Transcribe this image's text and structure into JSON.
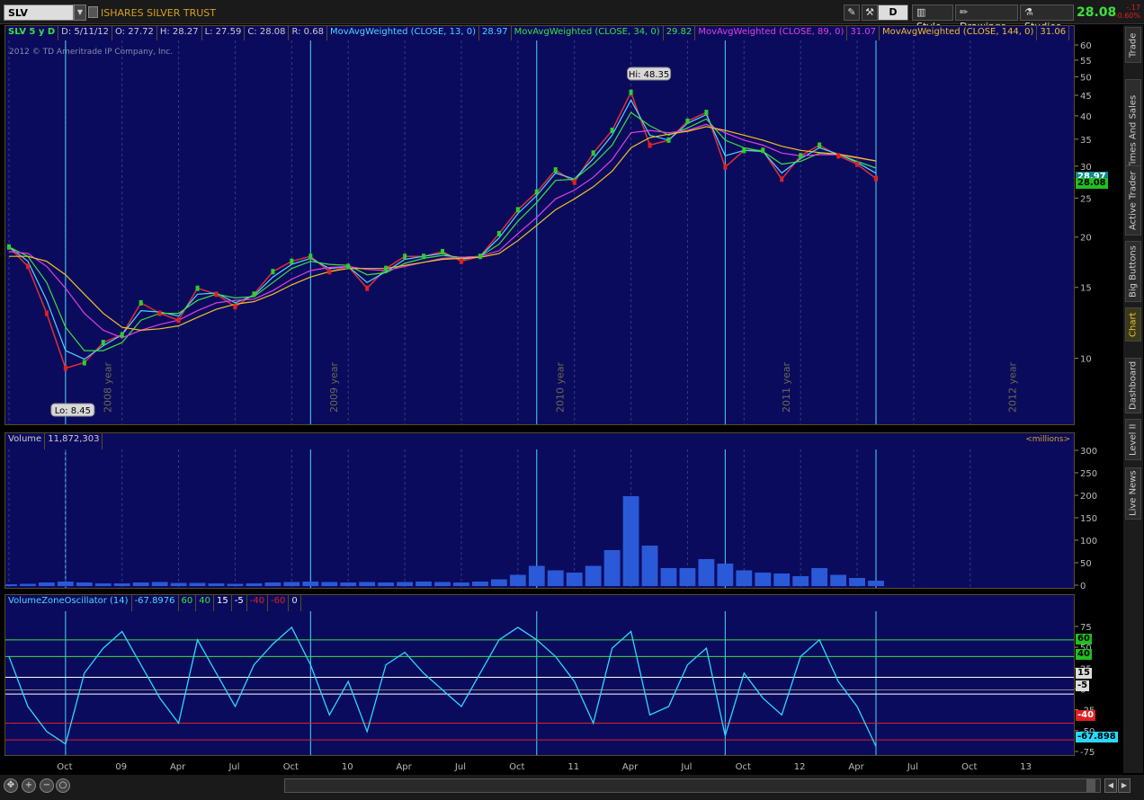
{
  "toolbar": {
    "symbol": "SLV",
    "description": "ISHARES SILVER TRUST",
    "aggregation": "D",
    "style_label": "Style",
    "drawings_label": "Drawings",
    "studies_label": "Studies",
    "last_price": "28.08",
    "net_change": "-.17",
    "pct_change": "-0.60%"
  },
  "price_panel": {
    "header": {
      "symbol_label": "SLV 5 y D",
      "date": "D: 5/11/12",
      "open": "O: 27.72",
      "high": "H: 28.27",
      "low": "L: 27.59",
      "close": "C: 28.08",
      "range": "R: 0.68",
      "ma13_label": "MovAvgWeighted (CLOSE, 13, 0)",
      "ma13_value": "28.97",
      "ma34_label": "MovAvgWeighted (CLOSE, 34, 0)",
      "ma34_value": "29.82",
      "ma89_label": "MovAvgWeighted (CLOSE, 89, 0)",
      "ma89_value": "31.07",
      "ma144_label": "MovAvgWeighted (CLOSE, 144, 0)",
      "ma144_value": "31.06"
    },
    "copyright": "2012 © TD Ameritrade IP Company, Inc.",
    "hi_label": "Hi: 48.35",
    "lo_label": "Lo: 8.45",
    "price_tag_1": "28.97",
    "price_tag_2": "28.08"
  },
  "volume_panel": {
    "label": "Volume",
    "value": "11,872,303",
    "units": "<millions>"
  },
  "oscillator_panel": {
    "label": "VolumeZoneOscillator (14)",
    "value": "-67.8976",
    "levels": [
      "60",
      "40",
      "15",
      "-5",
      "-40",
      "-60",
      "0"
    ],
    "tag_current": "-67.898"
  },
  "x_axis": {
    "labels": [
      "Oct",
      "09",
      "Apr",
      "Jul",
      "Oct",
      "10",
      "Apr",
      "Jul",
      "Oct",
      "11",
      "Apr",
      "Jul",
      "Oct",
      "12",
      "Apr",
      "Jul",
      "Oct",
      "13"
    ],
    "year_watermarks": [
      "2008 year",
      "2009 year",
      "2010 year",
      "2011 year",
      "2012 year"
    ]
  },
  "side_tabs": [
    "Trade",
    "Times And Sales",
    "Active Trader",
    "Big Buttons",
    "Chart",
    "Dashboard",
    "Level II",
    "Live News"
  ],
  "chart_data": [
    {
      "type": "line",
      "title": "SLV 5 y D",
      "ylabel": "",
      "yscale": "log",
      "ylim": [
        7,
        60
      ],
      "y_ticks": [
        10,
        15,
        20,
        25,
        30,
        35,
        40,
        45,
        50,
        55,
        60
      ],
      "x": [
        "2008-07",
        "2008-08",
        "2008-09",
        "2008-10",
        "2008-11",
        "2008-12",
        "2009-01",
        "2009-02",
        "2009-03",
        "2009-04",
        "2009-05",
        "2009-06",
        "2009-07",
        "2009-08",
        "2009-09",
        "2009-10",
        "2009-11",
        "2009-12",
        "2010-01",
        "2010-02",
        "2010-03",
        "2010-04",
        "2010-05",
        "2010-06",
        "2010-07",
        "2010-08",
        "2010-09",
        "2010-10",
        "2010-11",
        "2010-12",
        "2011-01",
        "2011-02",
        "2011-03",
        "2011-04",
        "2011-05",
        "2011-06",
        "2011-07",
        "2011-08",
        "2011-09",
        "2011-10",
        "2011-11",
        "2011-12",
        "2012-01",
        "2012-02",
        "2012-03",
        "2012-04",
        "2012-05"
      ],
      "series": [
        {
          "name": "SLV",
          "values": [
            19,
            17,
            13,
            9.5,
            9.8,
            11,
            11.5,
            13.8,
            13,
            12.5,
            15,
            14.5,
            13.5,
            14.5,
            16.5,
            17.5,
            18,
            16.5,
            17,
            15,
            16.8,
            18,
            18,
            18.5,
            17.5,
            18,
            20.5,
            23.5,
            26,
            29.5,
            27.5,
            32.5,
            37,
            46,
            34,
            35,
            39,
            41,
            30,
            33,
            33,
            28,
            32,
            34,
            32,
            30.5,
            28.08
          ]
        },
        {
          "name": "MovAvgWeighted (CLOSE, 13, 0)",
          "values": [
            19,
            17.5,
            14,
            10.5,
            10,
            10.8,
            11.5,
            13.2,
            13.1,
            12.8,
            14.5,
            14.6,
            13.8,
            14.4,
            16,
            17.2,
            17.8,
            16.8,
            17,
            15.5,
            16.5,
            17.7,
            18,
            18.3,
            17.7,
            18,
            20,
            23,
            25.5,
            29,
            28,
            31.5,
            36,
            44,
            36,
            35,
            38.5,
            40.5,
            32,
            33,
            32.8,
            29,
            31.5,
            33.5,
            32.3,
            30.8,
            28.97
          ]
        },
        {
          "name": "MovAvgWeighted (CLOSE, 34, 0)",
          "values": [
            19,
            18,
            15.5,
            12,
            10.5,
            10.5,
            11,
            12.5,
            13,
            13,
            14,
            14.5,
            14.2,
            14.3,
            15.5,
            16.8,
            17.5,
            17.2,
            17.1,
            16.2,
            16.4,
            17.3,
            17.8,
            18.1,
            17.9,
            18,
            19.3,
            22,
            24.5,
            27.8,
            28,
            30.5,
            34,
            41,
            38,
            36,
            37.5,
            39.5,
            35,
            33.5,
            32.8,
            30.5,
            31,
            32.5,
            32.3,
            31,
            29.82
          ]
        },
        {
          "name": "MovAvgWeighted (CLOSE, 89, 0)",
          "values": [
            18.5,
            18.3,
            17,
            15,
            13,
            11.8,
            11.3,
            11.8,
            12.2,
            12.5,
            13.2,
            13.8,
            14,
            14.1,
            14.8,
            15.8,
            16.6,
            16.9,
            17,
            16.7,
            16.6,
            17,
            17.4,
            17.8,
            17.9,
            18,
            18.6,
            20.5,
            22.5,
            25,
            26.3,
            28.3,
            31.3,
            36.5,
            37,
            36.5,
            37,
            38.3,
            36.5,
            35,
            34,
            32.5,
            32,
            32.2,
            32.2,
            31.6,
            31.07
          ]
        },
        {
          "name": "MovAvgWeighted (CLOSE, 144, 0)",
          "values": [
            18,
            18,
            17.5,
            16.2,
            14.5,
            13,
            12,
            11.8,
            11.9,
            12.1,
            12.7,
            13.3,
            13.7,
            13.9,
            14.5,
            15.3,
            16,
            16.5,
            16.8,
            16.8,
            16.8,
            17.1,
            17.4,
            17.7,
            17.8,
            17.9,
            18.3,
            19.7,
            21.5,
            23.5,
            25,
            26.8,
            29.3,
            33.5,
            35.5,
            36.2,
            36.8,
            37.8,
            37,
            36,
            35,
            33.8,
            33,
            32.6,
            32.3,
            31.7,
            31.06
          ]
        }
      ],
      "annotations": [
        "Hi: 48.35",
        "Lo: 8.45"
      ],
      "grid": true
    },
    {
      "type": "bar",
      "title": "Volume",
      "ylabel": "<millions>",
      "ylim": [
        0,
        300
      ],
      "y_ticks": [
        0,
        50,
        100,
        150,
        200,
        250,
        300
      ],
      "x": [
        "2008-07",
        "2008-08",
        "2008-09",
        "2008-10",
        "2008-11",
        "2008-12",
        "2009-01",
        "2009-02",
        "2009-03",
        "2009-04",
        "2009-05",
        "2009-06",
        "2009-07",
        "2009-08",
        "2009-09",
        "2009-10",
        "2009-11",
        "2009-12",
        "2010-01",
        "2010-02",
        "2010-03",
        "2010-04",
        "2010-05",
        "2010-06",
        "2010-07",
        "2010-08",
        "2010-09",
        "2010-10",
        "2010-11",
        "2010-12",
        "2011-01",
        "2011-02",
        "2011-03",
        "2011-04",
        "2011-05",
        "2011-06",
        "2011-07",
        "2011-08",
        "2011-09",
        "2011-10",
        "2011-11",
        "2011-12",
        "2012-01",
        "2012-02",
        "2012-03",
        "2012-04",
        "2012-05"
      ],
      "values": [
        4,
        5,
        8,
        10,
        8,
        6,
        6,
        8,
        9,
        7,
        7,
        6,
        5,
        6,
        8,
        9,
        10,
        9,
        8,
        9,
        8,
        9,
        10,
        9,
        8,
        10,
        15,
        25,
        45,
        35,
        30,
        45,
        80,
        200,
        90,
        40,
        40,
        60,
        50,
        35,
        30,
        28,
        22,
        40,
        25,
        18,
        12
      ]
    },
    {
      "type": "line",
      "title": "VolumeZoneOscillator (14)",
      "ylim": [
        -75,
        90
      ],
      "y_ticks": [
        75,
        50,
        25,
        0,
        -25,
        -50,
        -75
      ],
      "levels": [
        60,
        40,
        15,
        -5,
        -40,
        -60,
        0
      ],
      "x": [
        "2008-07",
        "2008-08",
        "2008-09",
        "2008-10",
        "2008-11",
        "2008-12",
        "2009-01",
        "2009-02",
        "2009-03",
        "2009-04",
        "2009-05",
        "2009-06",
        "2009-07",
        "2009-08",
        "2009-09",
        "2009-10",
        "2009-11",
        "2009-12",
        "2010-01",
        "2010-02",
        "2010-03",
        "2010-04",
        "2010-05",
        "2010-06",
        "2010-07",
        "2010-08",
        "2010-09",
        "2010-10",
        "2010-11",
        "2010-12",
        "2011-01",
        "2011-02",
        "2011-03",
        "2011-04",
        "2011-05",
        "2011-06",
        "2011-07",
        "2011-08",
        "2011-09",
        "2011-10",
        "2011-11",
        "2011-12",
        "2012-01",
        "2012-02",
        "2012-03",
        "2012-04",
        "2012-05"
      ],
      "series": [
        {
          "name": "VolumeZoneOscillator",
          "values": [
            40,
            -20,
            -50,
            -65,
            20,
            50,
            70,
            30,
            -10,
            -40,
            60,
            20,
            -20,
            30,
            55,
            75,
            30,
            -30,
            10,
            -50,
            30,
            45,
            20,
            0,
            -20,
            20,
            60,
            75,
            60,
            40,
            10,
            -40,
            50,
            70,
            -30,
            -20,
            30,
            50,
            -55,
            20,
            -10,
            -30,
            40,
            60,
            10,
            -20,
            -67.9
          ]
        }
      ]
    }
  ]
}
